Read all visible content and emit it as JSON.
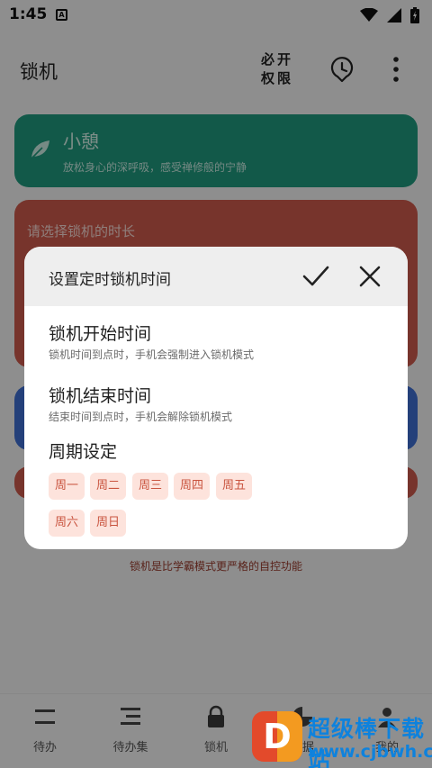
{
  "status_bar": {
    "time": "1:45",
    "notification_glyph": "A"
  },
  "app_bar": {
    "title": "锁机",
    "permission_line1": "必开",
    "permission_line2": "权限"
  },
  "cards": {
    "rest": {
      "title": "小憩",
      "subtitle": "放松身心的深呼吸，感受禅修般的宁静"
    },
    "duration": {
      "title": "请选择锁机的时长"
    },
    "footnote": "锁机是比学霸模式更严格的自控功能"
  },
  "dialog": {
    "title": "设置定时锁机时间",
    "start": {
      "title": "锁机开始时间",
      "subtitle": "锁机时间到点时，手机会强制进入锁机模式"
    },
    "end": {
      "title": "锁机结束时间",
      "subtitle": "结束时间到点时，手机会解除锁机模式"
    },
    "cycle": {
      "title": "周期设定",
      "days": [
        "周一",
        "周二",
        "周三",
        "周四",
        "周五",
        "周六",
        "周日"
      ]
    }
  },
  "bottom_nav": {
    "items": [
      {
        "label": "待办",
        "icon": "list-icon"
      },
      {
        "label": "待办集",
        "icon": "stacked-list-icon"
      },
      {
        "label": "锁机",
        "icon": "lock-icon",
        "active": true
      },
      {
        "label": "数据",
        "icon": "pie-chart-icon"
      },
      {
        "label": "我的",
        "icon": "person-icon"
      }
    ]
  },
  "watermark": {
    "logo_letter": "D",
    "line1": "超级棒下载站",
    "line2": "www.cjbwh.com"
  },
  "colors": {
    "green_card": "#1f9a7e",
    "red_card": "#cd5b4c",
    "blue_card": "#3f6fd3",
    "chip_bg": "#fde3dc",
    "chip_text": "#c9543f",
    "watermark_blue": "#0e82dd"
  }
}
